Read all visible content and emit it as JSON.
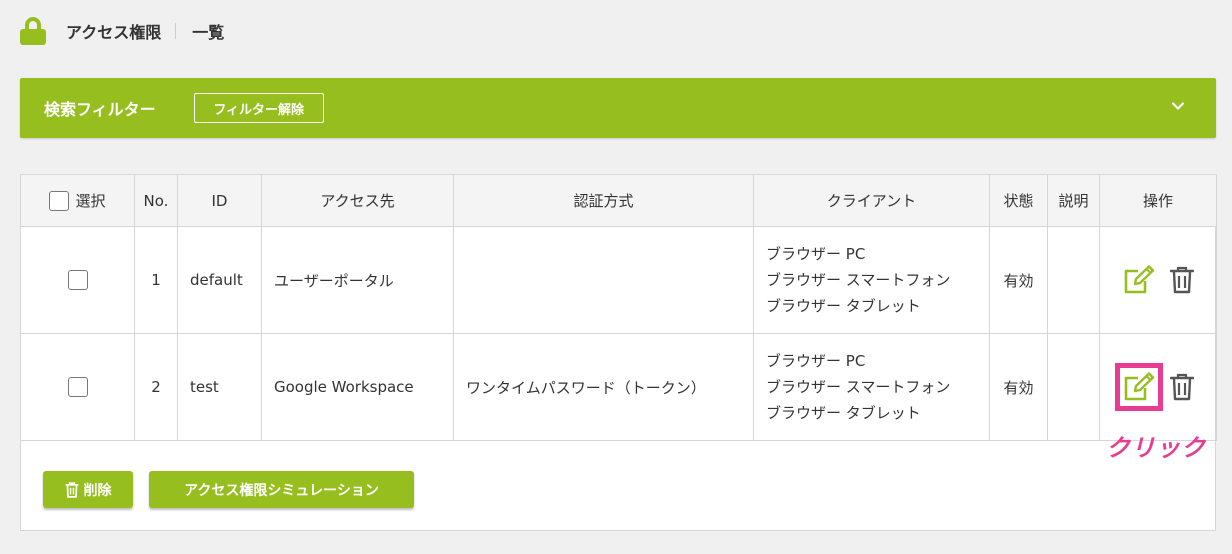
{
  "header": {
    "title": "アクセス権限",
    "subtitle": "一覧"
  },
  "filter": {
    "title": "検索フィルター",
    "clear_label": "フィルター解除"
  },
  "table": {
    "headers": {
      "select": "選択",
      "no": "No.",
      "id": "ID",
      "target": "アクセス先",
      "auth": "認証方式",
      "client": "クライアント",
      "status": "状態",
      "desc": "説明",
      "ops": "操作"
    },
    "rows": [
      {
        "no": "1",
        "id": "default",
        "target": "ユーザーポータル",
        "auth": "",
        "clients": [
          "ブラウザー PC",
          "ブラウザー スマートフォン",
          "ブラウザー タブレット"
        ],
        "status": "有効",
        "desc": ""
      },
      {
        "no": "2",
        "id": "test",
        "target": "Google Workspace",
        "auth": "ワンタイムパスワード（トークン）",
        "clients": [
          "ブラウザー PC",
          "ブラウザー スマートフォン",
          "ブラウザー タブレット"
        ],
        "status": "有効",
        "desc": ""
      }
    ]
  },
  "buttons": {
    "delete_label": "削除",
    "simulate_label": "アクセス権限シミュレーション"
  },
  "annotation": {
    "click_label": "クリック"
  },
  "colors": {
    "accent": "#97be1f",
    "highlight": "#e63d92"
  },
  "icons": [
    "lock-icon",
    "chevron-down-icon",
    "edit-icon",
    "trash-icon"
  ]
}
